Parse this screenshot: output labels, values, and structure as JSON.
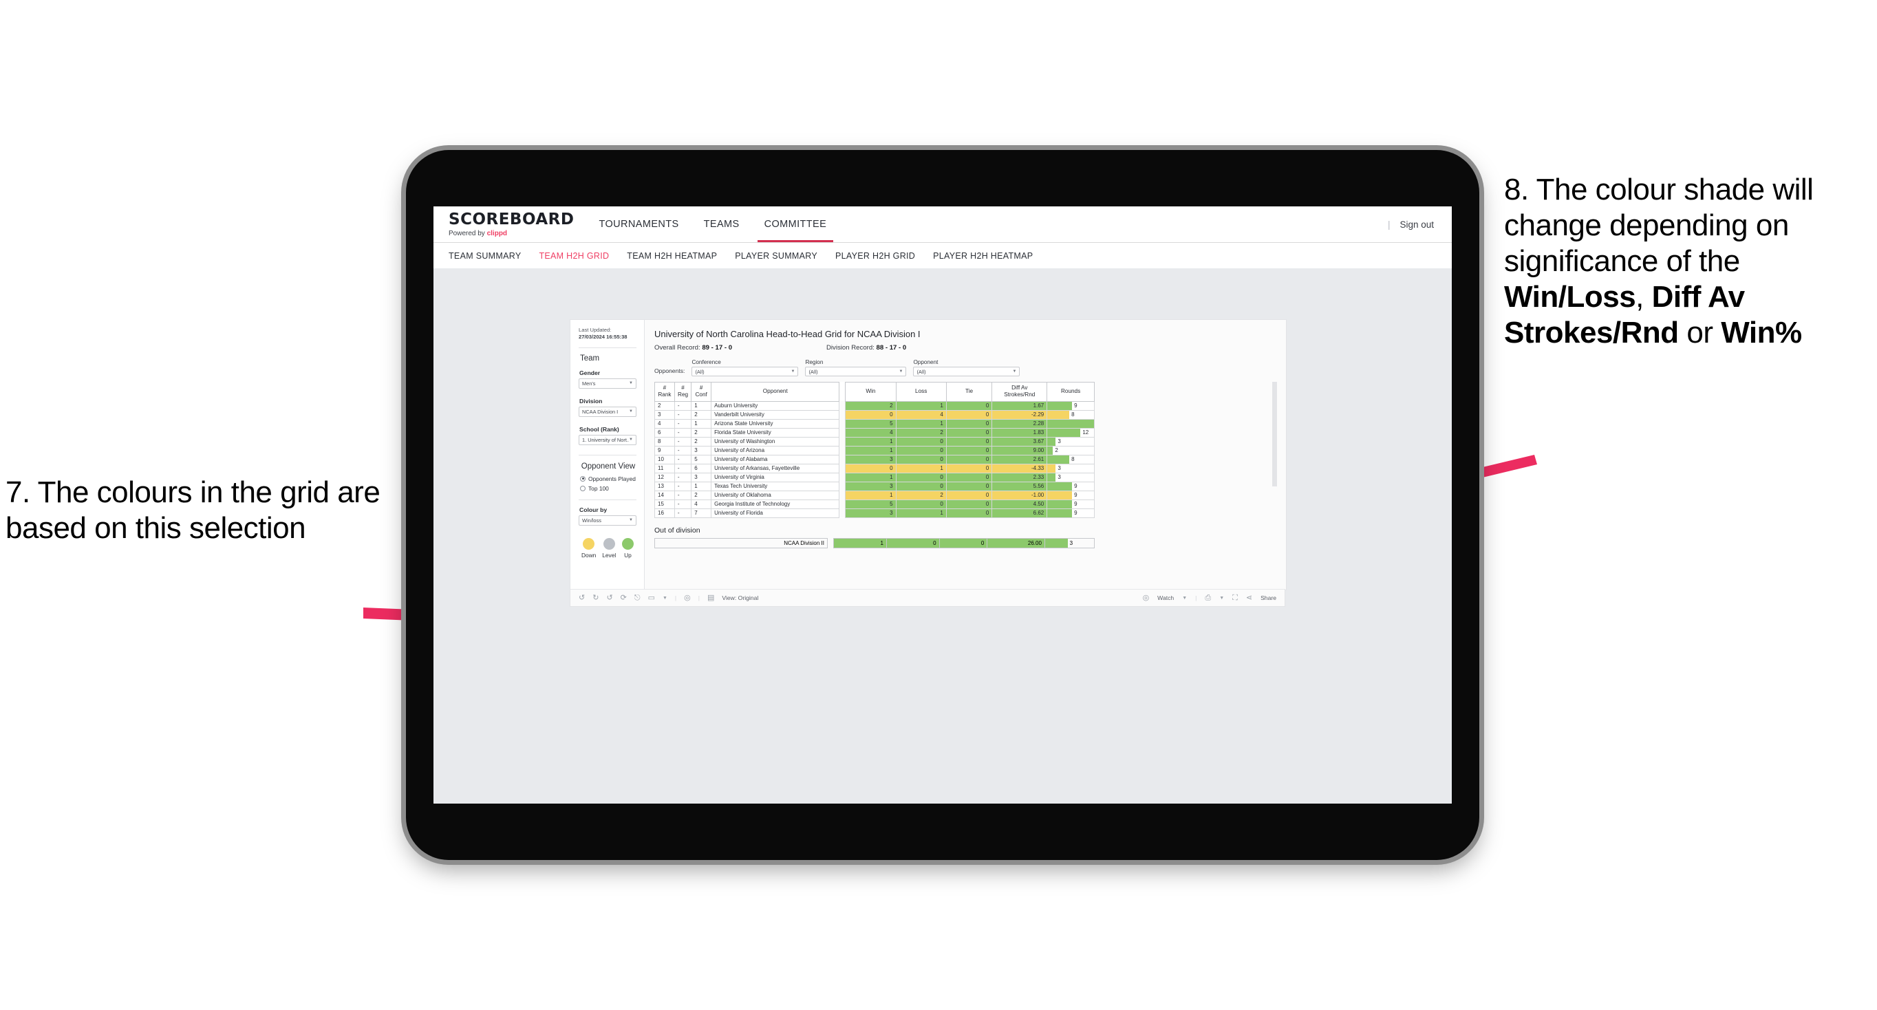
{
  "annotations": {
    "left": {
      "number": "7.",
      "text": "The colours in the grid are based on this selection"
    },
    "right": {
      "number": "8.",
      "text_before": "The colour shade will change depending on significance of the ",
      "bold_1": "Win/Loss",
      "sep_1": ", ",
      "bold_2": "Diff Av Strokes/Rnd",
      "sep_2": " or ",
      "bold_3": "Win%"
    },
    "arrow_color": "#ec2c60"
  },
  "app": {
    "brand": {
      "logo": "SCOREBOARD",
      "powered_prefix": "Powered by ",
      "powered_name": "clippd"
    },
    "top_nav": [
      {
        "label": "TOURNAMENTS",
        "active": false
      },
      {
        "label": "TEAMS",
        "active": false
      },
      {
        "label": "COMMITTEE",
        "active": true
      }
    ],
    "sign_out": "Sign out",
    "sub_nav": [
      {
        "label": "TEAM SUMMARY",
        "active": false
      },
      {
        "label": "TEAM H2H GRID",
        "active": true
      },
      {
        "label": "TEAM H2H HEATMAP",
        "active": false
      },
      {
        "label": "PLAYER SUMMARY",
        "active": false
      },
      {
        "label": "PLAYER H2H GRID",
        "active": false
      },
      {
        "label": "PLAYER H2H HEATMAP",
        "active": false
      }
    ]
  },
  "sidebar": {
    "last_updated_label": "Last Updated: ",
    "last_updated_value": "27/03/2024 16:55:38",
    "team_heading": "Team",
    "gender_label": "Gender",
    "gender_value": "Men's",
    "division_label": "Division",
    "division_value": "NCAA Division I",
    "school_label": "School (Rank)",
    "school_value": "1. University of Nort...",
    "opponent_view_heading": "Opponent View",
    "opponent_view_options": [
      {
        "label": "Opponents Played",
        "selected": true
      },
      {
        "label": "Top 100",
        "selected": false
      }
    ],
    "colour_by_label": "Colour by",
    "colour_by_value": "Win/loss",
    "legend": [
      {
        "label": "Down",
        "color": "#f5d463"
      },
      {
        "label": "Level",
        "color": "#bcc0c6"
      },
      {
        "label": "Up",
        "color": "#8cc96b"
      }
    ]
  },
  "viz": {
    "title": "University of North Carolina Head-to-Head Grid for NCAA Division I",
    "overall_record_label": "Overall Record: ",
    "overall_record_value": "89 - 17 - 0",
    "division_record_label": "Division Record: ",
    "division_record_value": "88 - 17 - 0",
    "opponents_label": "Opponents:",
    "filters": [
      {
        "label": "Conference",
        "value": "(All)"
      },
      {
        "label": "Region",
        "value": "(All)"
      },
      {
        "label": "Opponent",
        "value": "(All)"
      }
    ],
    "out_of_division_title": "Out of division"
  },
  "chart_data": {
    "type": "table",
    "title": "University of North Carolina Head-to-Head Grid for NCAA Division I",
    "columns": [
      "# Rank",
      "# Reg",
      "# Conf",
      "Opponent",
      "Win",
      "Loss",
      "Tie",
      "Diff Av Strokes/Rnd",
      "Rounds"
    ],
    "rows": [
      {
        "rank": "2",
        "reg": "-",
        "conf": "1",
        "opponent": "Auburn University",
        "win": "2",
        "loss": "1",
        "tie": "0",
        "diff": "1.67",
        "rounds": "9",
        "color": "up"
      },
      {
        "rank": "3",
        "reg": "-",
        "conf": "2",
        "opponent": "Vanderbilt University",
        "win": "0",
        "loss": "4",
        "tie": "0",
        "diff": "-2.29",
        "rounds": "8",
        "color": "down"
      },
      {
        "rank": "4",
        "reg": "-",
        "conf": "1",
        "opponent": "Arizona State University",
        "win": "5",
        "loss": "1",
        "tie": "0",
        "diff": "2.28",
        "rounds": "17",
        "color": "up"
      },
      {
        "rank": "6",
        "reg": "-",
        "conf": "2",
        "opponent": "Florida State University",
        "win": "4",
        "loss": "2",
        "tie": "0",
        "diff": "1.83",
        "rounds": "12",
        "color": "up"
      },
      {
        "rank": "8",
        "reg": "-",
        "conf": "2",
        "opponent": "University of Washington",
        "win": "1",
        "loss": "0",
        "tie": "0",
        "diff": "3.67",
        "rounds": "3",
        "color": "up"
      },
      {
        "rank": "9",
        "reg": "-",
        "conf": "3",
        "opponent": "University of Arizona",
        "win": "1",
        "loss": "0",
        "tie": "0",
        "diff": "9.00",
        "rounds": "2",
        "color": "up"
      },
      {
        "rank": "10",
        "reg": "-",
        "conf": "5",
        "opponent": "University of Alabama",
        "win": "3",
        "loss": "0",
        "tie": "0",
        "diff": "2.61",
        "rounds": "8",
        "color": "up"
      },
      {
        "rank": "11",
        "reg": "-",
        "conf": "6",
        "opponent": "University of Arkansas, Fayetteville",
        "win": "0",
        "loss": "1",
        "tie": "0",
        "diff": "-4.33",
        "rounds": "3",
        "color": "down"
      },
      {
        "rank": "12",
        "reg": "-",
        "conf": "3",
        "opponent": "University of Virginia",
        "win": "1",
        "loss": "0",
        "tie": "0",
        "diff": "2.33",
        "rounds": "3",
        "color": "up"
      },
      {
        "rank": "13",
        "reg": "-",
        "conf": "1",
        "opponent": "Texas Tech University",
        "win": "3",
        "loss": "0",
        "tie": "0",
        "diff": "5.56",
        "rounds": "9",
        "color": "up"
      },
      {
        "rank": "14",
        "reg": "-",
        "conf": "2",
        "opponent": "University of Oklahoma",
        "win": "1",
        "loss": "2",
        "tie": "0",
        "diff": "-1.00",
        "rounds": "9",
        "color": "down"
      },
      {
        "rank": "15",
        "reg": "-",
        "conf": "4",
        "opponent": "Georgia Institute of Technology",
        "win": "5",
        "loss": "0",
        "tie": "0",
        "diff": "4.50",
        "rounds": "9",
        "color": "up"
      },
      {
        "rank": "16",
        "reg": "-",
        "conf": "7",
        "opponent": "University of Florida",
        "win": "3",
        "loss": "1",
        "tie": "0",
        "diff": "6.62",
        "rounds": "9",
        "color": "up"
      }
    ],
    "out_of_division": [
      {
        "opponent": "NCAA Division II",
        "win": "1",
        "loss": "0",
        "tie": "0",
        "diff": "26.00",
        "rounds": "3",
        "color": "up"
      }
    ],
    "colors": {
      "up": "#8cc96b",
      "down": "#f5d463",
      "level": "#bcc0c6"
    },
    "rounds_max": 17
  },
  "toolbar": {
    "icons": [
      "undo-icon",
      "redo-icon",
      "revert-icon",
      "refresh-icon",
      "pause-icon",
      "shape-icon"
    ],
    "view_label": "View: Original",
    "watch_label": "Watch",
    "share_label": "Share"
  }
}
